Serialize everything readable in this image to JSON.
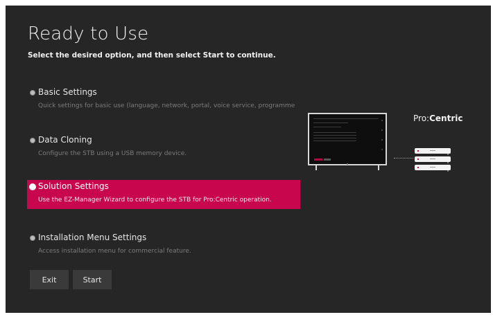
{
  "header": {
    "title": "Ready to Use",
    "subtitle": "Select the desired option, and then select Start to continue."
  },
  "options": [
    {
      "label": "Basic Settings",
      "description": "Quick settings for basic use (language, network, portal, voice service, programme tuni...",
      "selected": false
    },
    {
      "label": "Data Cloning",
      "description": "Configure the STB using a USB memory device.",
      "selected": false
    },
    {
      "label": "Solution Settings",
      "description": "Use the EZ-Manager Wizard to configure the STB for Pro:Centric operation.",
      "selected": true
    },
    {
      "label": "Installation Menu Settings",
      "description": "Access installation menu for commercial feature.",
      "selected": false
    }
  ],
  "buttons": {
    "exit_label": "Exit",
    "start_label": "Start"
  },
  "illustration": {
    "brand_prefix": "Pro:",
    "brand_suffix": "Centric"
  },
  "colors": {
    "background": "#262626",
    "accent": "#c8064e",
    "button": "#3a3a3a"
  }
}
